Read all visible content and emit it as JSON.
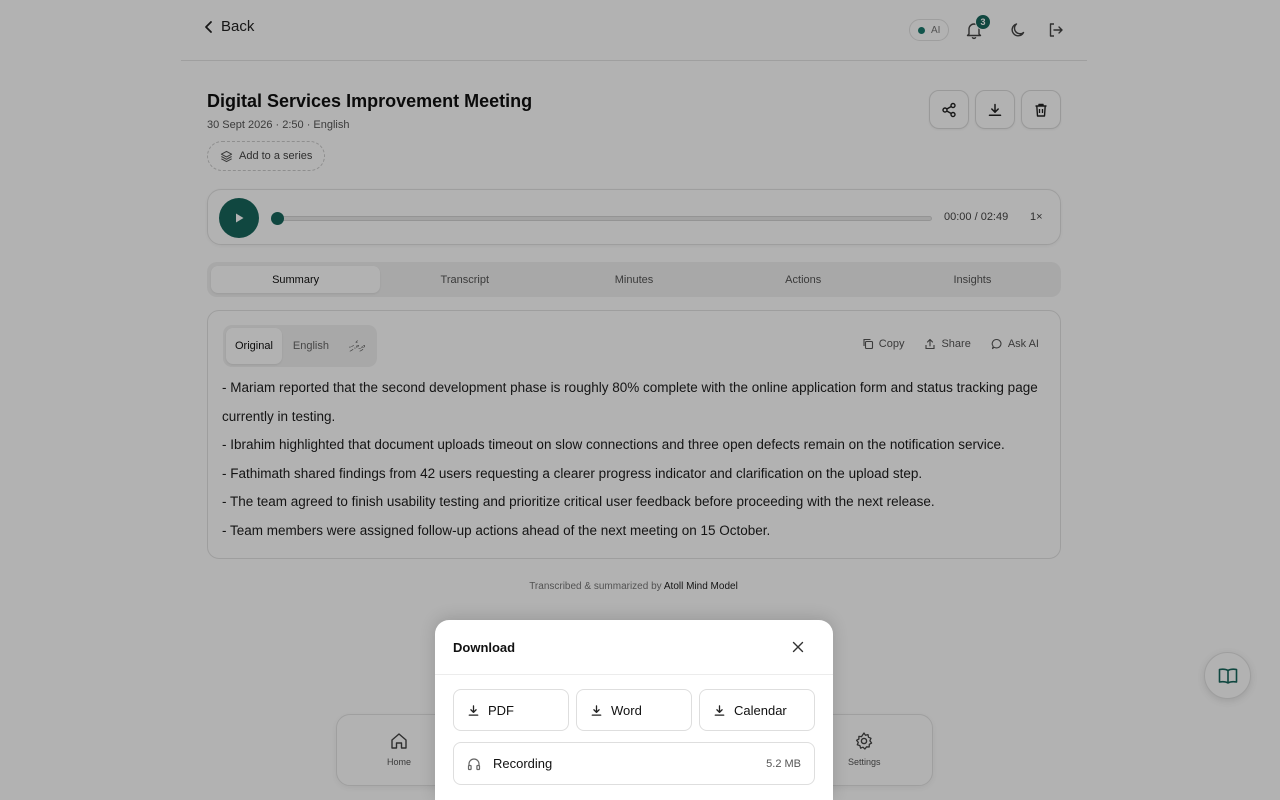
{
  "header": {
    "back_label": "Back",
    "ai_label": "AI",
    "notification_count": "3"
  },
  "meeting": {
    "title": "Digital Services Improvement Meeting",
    "meta": "30 Sept 2026 · 2:50 · English",
    "add_series_label": "Add to a series"
  },
  "player": {
    "time": "00:00 / 02:49",
    "speed": "1×",
    "progress": 0
  },
  "tabs": [
    {
      "label": "Summary",
      "active": true
    },
    {
      "label": "Transcript",
      "active": false
    },
    {
      "label": "Minutes",
      "active": false
    },
    {
      "label": "Actions",
      "active": false
    },
    {
      "label": "Insights",
      "active": false
    }
  ],
  "summary": {
    "languages": {
      "original": "Original",
      "english": "English",
      "dhivehi": "ދިވެހި"
    },
    "tools": {
      "copy": "Copy",
      "share": "Share",
      "ask_ai": "Ask AI"
    },
    "points": [
      "- Mariam reported that the second development phase is roughly 80% complete with the online application form and status tracking page currently in testing.",
      "- Ibrahim highlighted that document uploads timeout on slow connections and three open defects remain on the notification service.",
      "- Fathimath shared findings from 42 users requesting a clearer progress indicator and clarification on the upload step.",
      "- The team agreed to finish usability testing and prioritize critical user feedback before proceeding with the next release.",
      "- Team members were assigned follow-up actions ahead of the next meeting on 15 October."
    ]
  },
  "credit": {
    "prefix": "Transcribed & summarized by",
    "model": "Atoll Mind Model"
  },
  "bottom_nav": {
    "home": "Home",
    "settings": "Settings"
  },
  "download_modal": {
    "title": "Download",
    "pdf": "PDF",
    "word": "Word",
    "calendar": "Calendar",
    "recording": "Recording",
    "recording_size": "5.2 MB"
  },
  "colors": {
    "accent": "#17665c"
  }
}
